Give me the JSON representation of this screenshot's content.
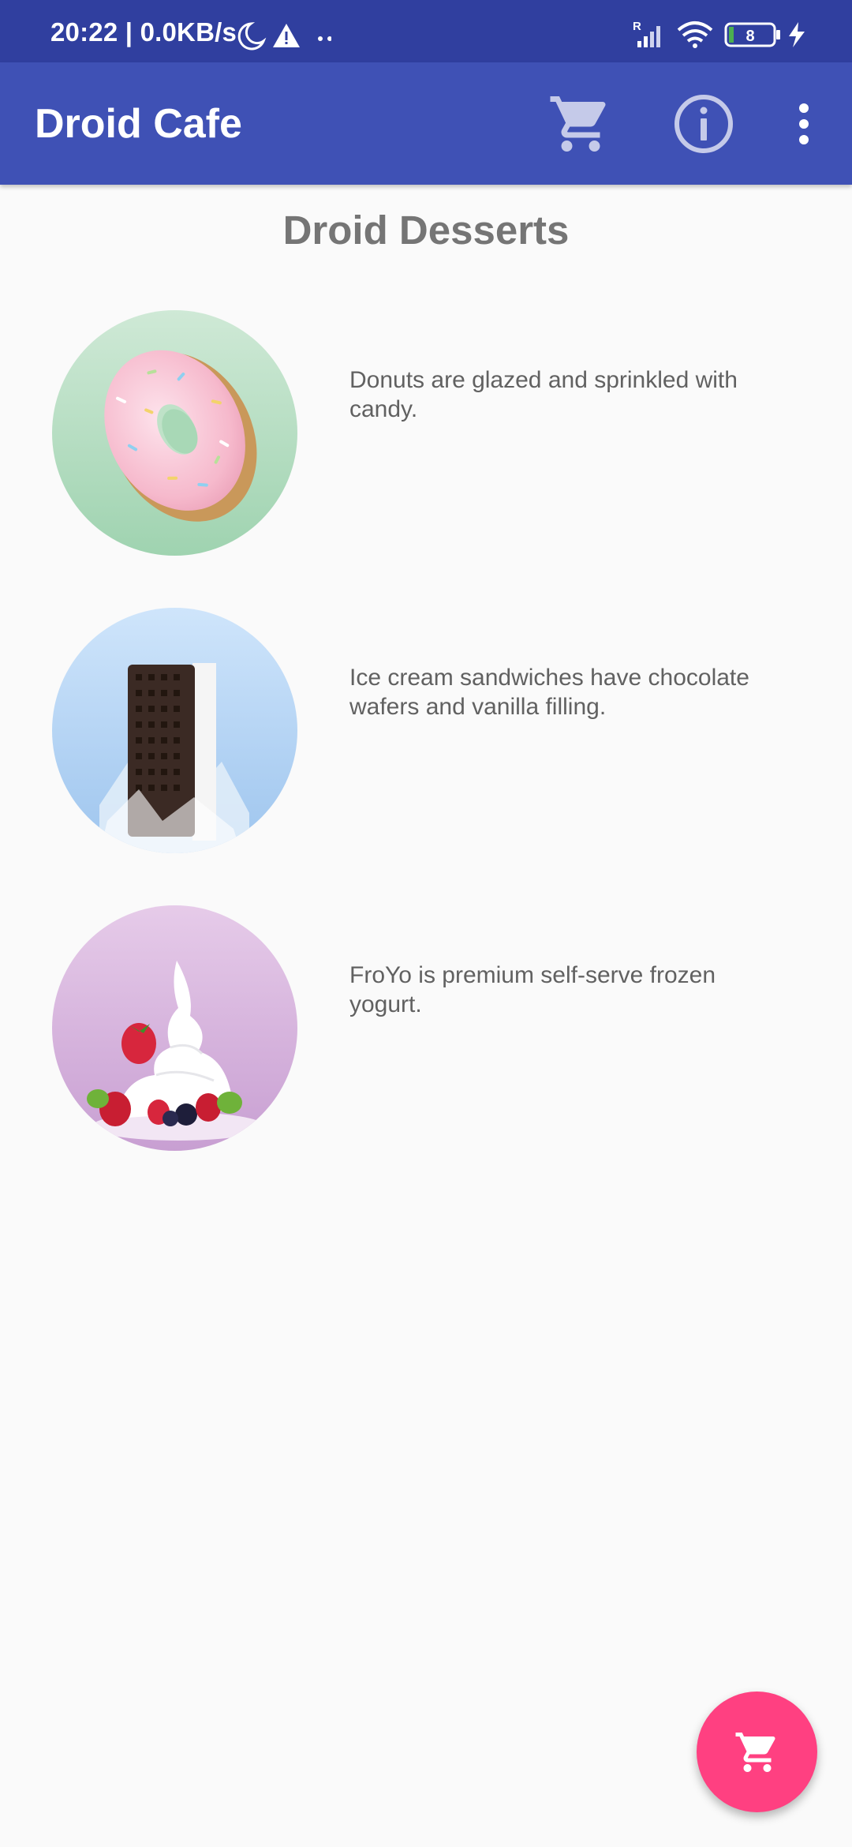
{
  "status_bar": {
    "time_info": "20:22 | 0.0KB/s",
    "battery_level": "8",
    "network_label": "R"
  },
  "app_bar": {
    "title": "Droid Cafe",
    "icons": [
      "cart-icon",
      "info-icon",
      "more-vert-icon"
    ]
  },
  "page": {
    "title": "Droid Desserts"
  },
  "desserts": [
    {
      "description": "Donuts are glazed and sprinkled with candy.",
      "image": "donut-image"
    },
    {
      "description": "Ice cream sandwiches have chocolate wafers and vanilla filling.",
      "image": "ice-cream-sandwich-image"
    },
    {
      "description": "FroYo is premium self-serve frozen yogurt.",
      "image": "froyo-image"
    }
  ],
  "fab": {
    "icon": "cart-icon"
  },
  "colors": {
    "status_bar": "#303f9f",
    "primary": "#3f51b5",
    "accent": "#ff4081",
    "background": "#fafafa",
    "title_text": "#757575",
    "body_text": "#616161"
  }
}
